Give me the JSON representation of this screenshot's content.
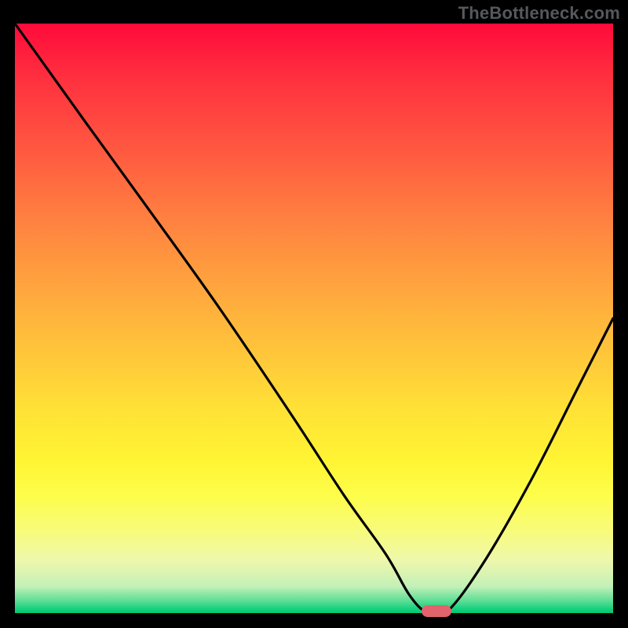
{
  "watermark": "TheBottleneck.com",
  "colors": {
    "background": "#000000",
    "marker": "#e2636c",
    "curve": "#000000"
  },
  "chart_data": {
    "type": "line",
    "title": "",
    "xlabel": "",
    "ylabel": "",
    "xlim": [
      0,
      100
    ],
    "ylim": [
      0,
      100
    ],
    "series": [
      {
        "name": "bottleneck-curve",
        "x": [
          0,
          12,
          22,
          34,
          46,
          55,
          62,
          66,
          69,
          72,
          78,
          86,
          94,
          100
        ],
        "values": [
          100,
          83,
          69,
          52,
          34,
          20,
          10,
          3,
          0,
          0,
          8,
          22,
          38,
          50
        ]
      }
    ],
    "marker": {
      "x_start": 68,
      "x_end": 73,
      "y": 0
    },
    "gradient_stops": [
      {
        "pos": 0.0,
        "color": "#ff0a3a"
      },
      {
        "pos": 0.33,
        "color": "#ff8040"
      },
      {
        "pos": 0.66,
        "color": "#ffe336"
      },
      {
        "pos": 0.86,
        "color": "#f8fb7a"
      },
      {
        "pos": 0.98,
        "color": "#59dd94"
      },
      {
        "pos": 1.0,
        "color": "#00c96e"
      }
    ]
  }
}
